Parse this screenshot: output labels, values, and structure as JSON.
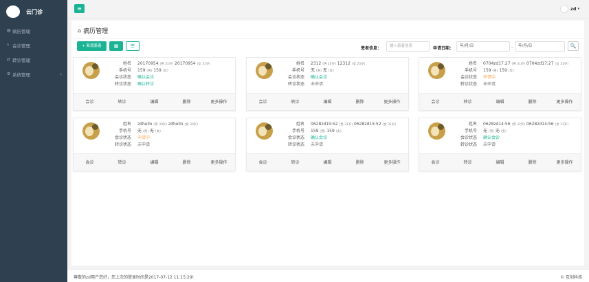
{
  "app": {
    "name": "云门诊"
  },
  "sidebar": {
    "items": [
      {
        "label": "病历管理",
        "icon": "file-icon"
      },
      {
        "label": "会诊管理",
        "icon": "consult-icon"
      },
      {
        "label": "转诊管理",
        "icon": "transfer-icon"
      },
      {
        "label": "系统管理",
        "icon": "gear-icon",
        "arrow": "‹"
      }
    ]
  },
  "topbar": {
    "menu_icon": "≡",
    "user_name": "zd",
    "caret": "▾"
  },
  "page": {
    "title": "病历管理",
    "home_icon": "⌂"
  },
  "toolbar": {
    "add_label": "+ 新增患者",
    "grid_icon": "▦",
    "list_icon": "☰",
    "patient_label": "患者信息：",
    "patient_placeholder": "输入患者信息",
    "date_label": "申请日期：",
    "date_from": "年/月/日",
    "date_sep": "-",
    "date_to": "年/月/日",
    "search_icon": "🔍"
  },
  "labels": {
    "name": "姓名",
    "phone": "手机号",
    "consult": "会诊状态",
    "transfer": "转诊状态"
  },
  "actions": [
    "会诊",
    "转诊",
    "编辑",
    "删除",
    "更多操作"
  ],
  "records": [
    {
      "name_main": "20170954",
      "name_sub": "(男 31岁)",
      "name_main2": "20170954",
      "name_sub2": "(女 31岁)",
      "phone_main": "159",
      "phone_sub": "(男)",
      "phone_main2": "159",
      "phone_sub2": "(女)",
      "consult": "确认会诊",
      "consult_color": "#1ab394",
      "transfer": "确认转诊",
      "transfer_color": "#1ab394"
    },
    {
      "name_main": "2312",
      "name_sub": "(男 24岁)",
      "name_main2": "12312",
      "name_sub2": "(女 25岁)",
      "phone_main": "无",
      "phone_sub": "(男)",
      "phone_main2": "无",
      "phone_sub2": "(女)",
      "consult": "确认会诊",
      "consult_color": "#1ab394",
      "transfer": "未申请",
      "transfer_color": "#777777"
    },
    {
      "name_main": "0704zd17:27",
      "name_sub": "(男 31岁)",
      "name_main2": "0704zd17:27",
      "name_sub2": "(女 31岁)",
      "phone_main": "159",
      "phone_sub": "(男)",
      "phone_main2": "159",
      "phone_sub2": "(女)",
      "consult": "申请中",
      "consult_color": "#f8ac59",
      "transfer": "未申请",
      "transfer_color": "#777777"
    },
    {
      "name_main": "zdhello",
      "name_sub": "(男 30岁)",
      "name_main2": "zdhello",
      "name_sub2": "(女 30岁)",
      "phone_main": "无",
      "phone_sub": "(男)",
      "phone_main2": "无",
      "phone_sub2": "(女)",
      "consult": "申请中",
      "consult_color": "#f8ac59",
      "transfer": "未申请",
      "transfer_color": "#777777"
    },
    {
      "name_main": "0628zd15:52",
      "name_sub": "(男 31岁)",
      "name_main2": "0628zd15:52",
      "name_sub2": "(女 31岁)",
      "phone_main": "159",
      "phone_sub": "(男)",
      "phone_main2": "159",
      "phone_sub2": "(女)",
      "consult": "确认会诊",
      "consult_color": "#1ab394",
      "transfer": "未申请",
      "transfer_color": "#777777"
    },
    {
      "name_main": "0628zd14:56",
      "name_sub": "(男 32岁)",
      "name_main2": "0628zd14:56",
      "name_sub2": "(女 31岁)",
      "phone_main": "无",
      "phone_sub": "(男)",
      "phone_main2": "无",
      "phone_sub2": "(女)",
      "consult": "确认会诊",
      "consult_color": "#1ab394",
      "transfer": "未申请",
      "transfer_color": "#777777"
    }
  ],
  "footer": {
    "left": "尊敬的zd用户您好，您上次的登录时间是2017-07-12 11:15:29!",
    "right": "© 互创科技"
  }
}
